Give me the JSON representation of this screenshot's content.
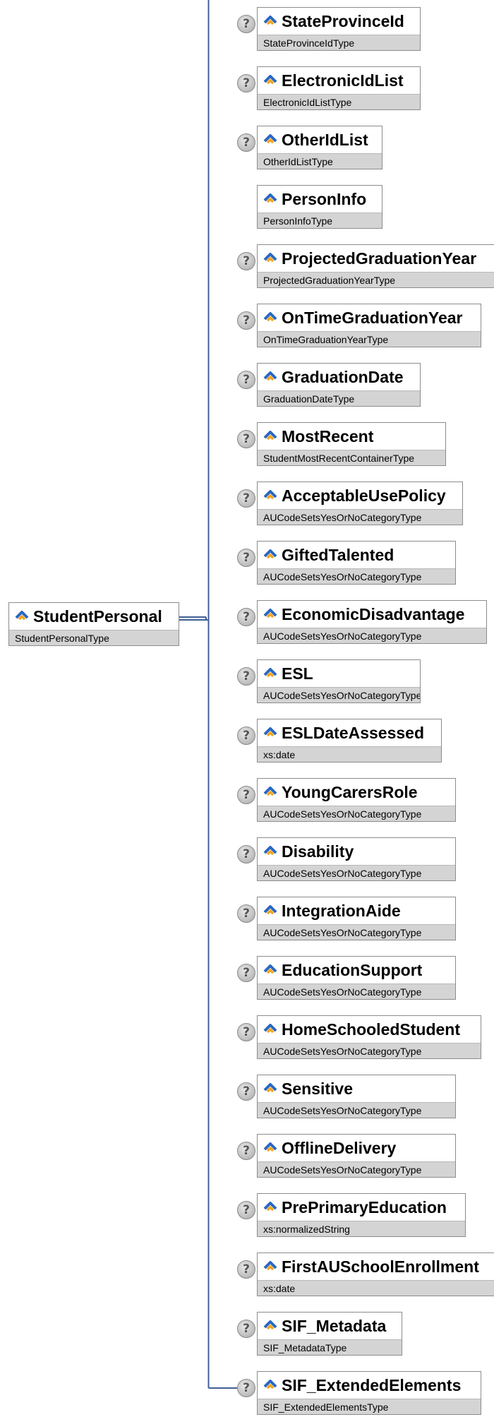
{
  "root": {
    "name": "StudentPersonal",
    "type": "StudentPersonalType"
  },
  "children": [
    {
      "name": "StateProvinceId",
      "type": "StateProvinceIdType",
      "optional": true
    },
    {
      "name": "ElectronicIdList",
      "type": "ElectronicIdListType",
      "optional": true
    },
    {
      "name": "OtherIdList",
      "type": "OtherIdListType",
      "optional": true
    },
    {
      "name": "PersonInfo",
      "type": "PersonInfoType",
      "optional": false
    },
    {
      "name": "ProjectedGraduationYear",
      "type": "ProjectedGraduationYearType",
      "optional": true
    },
    {
      "name": "OnTimeGraduationYear",
      "type": "OnTimeGraduationYearType",
      "optional": true
    },
    {
      "name": "GraduationDate",
      "type": "GraduationDateType",
      "optional": true
    },
    {
      "name": "MostRecent",
      "type": "StudentMostRecentContainerType",
      "optional": true
    },
    {
      "name": "AcceptableUsePolicy",
      "type": "AUCodeSetsYesOrNoCategoryType",
      "optional": true
    },
    {
      "name": "GiftedTalented",
      "type": "AUCodeSetsYesOrNoCategoryType",
      "optional": true
    },
    {
      "name": "EconomicDisadvantage",
      "type": "AUCodeSetsYesOrNoCategoryType",
      "optional": true
    },
    {
      "name": "ESL",
      "type": "AUCodeSetsYesOrNoCategoryType",
      "optional": true
    },
    {
      "name": "ESLDateAssessed",
      "type": "xs:date",
      "optional": true
    },
    {
      "name": "YoungCarersRole",
      "type": "AUCodeSetsYesOrNoCategoryType",
      "optional": true
    },
    {
      "name": "Disability",
      "type": "AUCodeSetsYesOrNoCategoryType",
      "optional": true
    },
    {
      "name": "IntegrationAide",
      "type": "AUCodeSetsYesOrNoCategoryType",
      "optional": true
    },
    {
      "name": "EducationSupport",
      "type": "AUCodeSetsYesOrNoCategoryType",
      "optional": true
    },
    {
      "name": "HomeSchooledStudent",
      "type": "AUCodeSetsYesOrNoCategoryType",
      "optional": true
    },
    {
      "name": "Sensitive",
      "type": "AUCodeSetsYesOrNoCategoryType",
      "optional": true
    },
    {
      "name": "OfflineDelivery",
      "type": "AUCodeSetsYesOrNoCategoryType",
      "optional": true
    },
    {
      "name": "PrePrimaryEducation",
      "type": "xs:normalizedString",
      "optional": true
    },
    {
      "name": "FirstAUSchoolEnrollment",
      "type": "xs:date",
      "optional": true
    },
    {
      "name": "SIF_Metadata",
      "type": "SIF_MetadataType",
      "optional": true
    },
    {
      "name": "SIF_ExtendedElements",
      "type": "SIF_ExtendedElementsType",
      "optional": true
    }
  ],
  "help_glyph": "?",
  "colors": {
    "connector": "#3f5f95",
    "icon_blue": "#2a67c2",
    "icon_orange": "#f2a51c",
    "type_band": "#d4d4d4",
    "border": "#8c8c8c"
  }
}
